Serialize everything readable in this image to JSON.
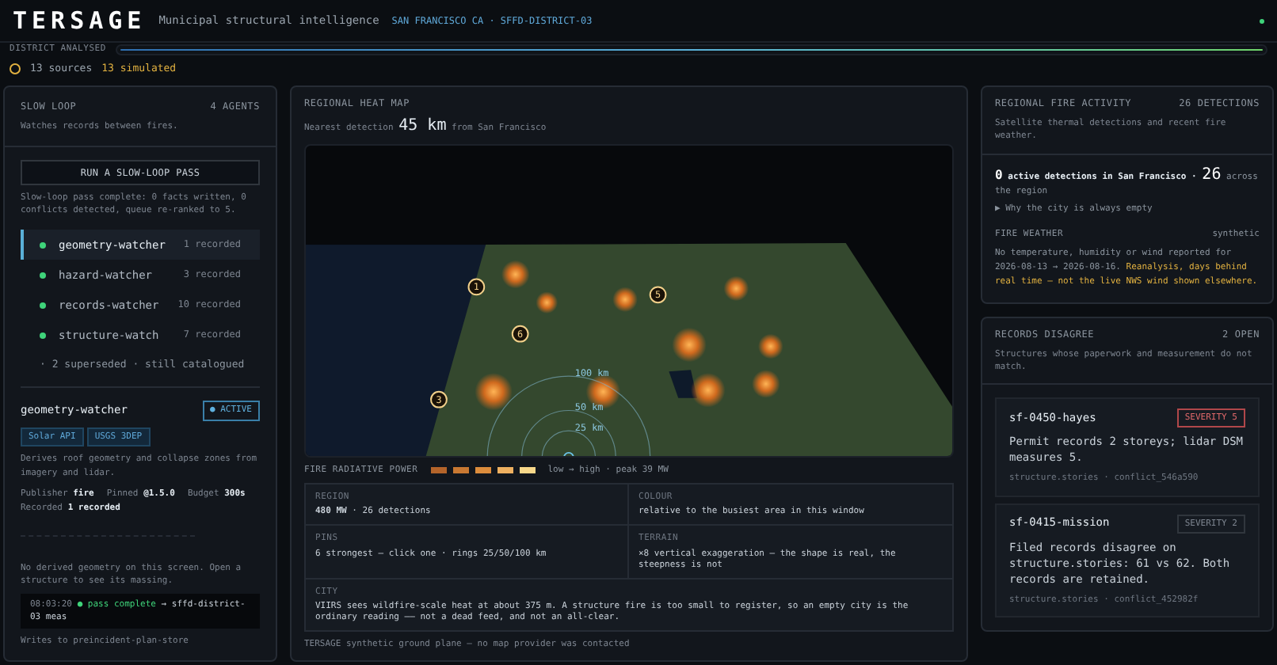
{
  "header": {
    "brand": "TERSAGE",
    "tagline": "Municipal structural intelligence",
    "location": "SAN FRANCISCO CA · SFFD-DISTRICT-03",
    "online": true
  },
  "progress": {
    "label": "DISTRICT ANALYSED",
    "level": 1
  },
  "sources": {
    "count": "13 sources",
    "simulated": "13 simulated"
  },
  "slow_loop": {
    "title": "SLOW LOOP",
    "count": "4 AGENTS",
    "subtitle": "Watches records between fires.",
    "button": "RUN A SLOW-LOOP PASS",
    "message": "Slow-loop pass complete: 0 facts written, 0 conflicts detected, queue re-ranked to 5.",
    "agents": [
      {
        "name": "geometry-watcher",
        "recorded": "1 recorded",
        "selected": true
      },
      {
        "name": "hazard-watcher",
        "recorded": "3 recorded",
        "selected": false
      },
      {
        "name": "records-watcher",
        "recorded": "10 recorded",
        "selected": false
      },
      {
        "name": "structure-watch",
        "recorded": "7 recorded",
        "selected": false
      }
    ],
    "superseded": "· 2 superseded · still catalogued",
    "detail": {
      "name": "geometry-watcher",
      "status": "● ACTIVE",
      "tags": [
        "Solar API",
        "USGS 3DEP"
      ],
      "description": "Derives roof geometry and collapse zones from imagery and lidar.",
      "meta": [
        {
          "label": "Publisher",
          "value": "fire"
        },
        {
          "label": "Pinned",
          "value": "@1.5.0"
        },
        {
          "label": "Budget",
          "value": "300s"
        },
        {
          "label": "Recorded",
          "value": "1 recorded"
        }
      ],
      "empty_note": "No derived geometry on this screen. Open a structure to see its massing.",
      "log": {
        "time": "08:03:20",
        "status": "● pass complete",
        "text": "→ sffd-district-03 meas"
      },
      "writes": "Writes to preincident-plan-store"
    }
  },
  "heat_map": {
    "title": "REGIONAL HEAT MAP",
    "nearest_label": "Nearest detection",
    "nearest_value": "45 km",
    "nearest_suffix": "from San Francisco",
    "pins": [
      "1",
      "5",
      "6",
      "3"
    ],
    "rings": [
      "100 km",
      "50 km",
      "25 km"
    ],
    "legend": {
      "label": "FIRE RADIATIVE POWER",
      "swatches": [
        {
          "color": "#b4642a"
        },
        {
          "color": "#c87832"
        },
        {
          "color": "#dc8c3c"
        },
        {
          "color": "#eeb060"
        },
        {
          "color": "#f8d88a"
        }
      ],
      "text": "low → high · peak 39 MW"
    },
    "facts": [
      {
        "label": "REGION",
        "value": "**480 MW** · 26 detections"
      },
      {
        "label": "COLOUR",
        "value": "relative to the busiest area in this window"
      },
      {
        "label": "PINS",
        "value": "6 strongest — click one · rings 25/50/100 km"
      },
      {
        "label": "TERRAIN",
        "value": "×8 vertical exaggeration — the shape is real, the steepness is not"
      },
      {
        "label": "CITY",
        "value": "VIIRS sees wildfire-scale heat at about 375 m. A structure fire is too small to register, so an empty city is the ordinary reading —— not a dead feed, and not an all-clear."
      }
    ],
    "footer": "TERSAGE synthetic ground plane — no map provider was contacted"
  },
  "fire_activity": {
    "title": "REGIONAL FIRE ACTIVITY",
    "count": "26 DETECTIONS",
    "subtitle": "Satellite thermal detections and recent fire weather.",
    "local_count": "0",
    "local_text": "active detections in San Francisco ·",
    "region_count": "26",
    "region_text": "across the region",
    "disclosure": "▶ Why the city is always empty",
    "weather_label": "FIRE WEATHER",
    "weather_tag": "synthetic",
    "weather_text": "No temperature, humidity or wind reported for 2026-08-13 → 2026-08-16.",
    "weather_warning": "Reanalysis, days behind real time — not the live NWS wind shown elsewhere."
  },
  "records": {
    "title": "RECORDS DISAGREE",
    "count": "2 OPEN",
    "subtitle": "Structures whose paperwork and measurement do not match.",
    "items": [
      {
        "id": "sf-0450-hayes",
        "severity": "SEVERITY 5",
        "kind": "high",
        "text": "Permit records 2 storeys; lidar DSM measures 5.",
        "meta": "structure.stories · conflict_546a590"
      },
      {
        "id": "sf-0415-mission",
        "severity": "SEVERITY 2",
        "kind": "normal",
        "text": "Filed records disagree on structure.stories: 61 vs 62. Both records are retained.",
        "meta": "structure.stories · conflict_452982f"
      }
    ]
  }
}
